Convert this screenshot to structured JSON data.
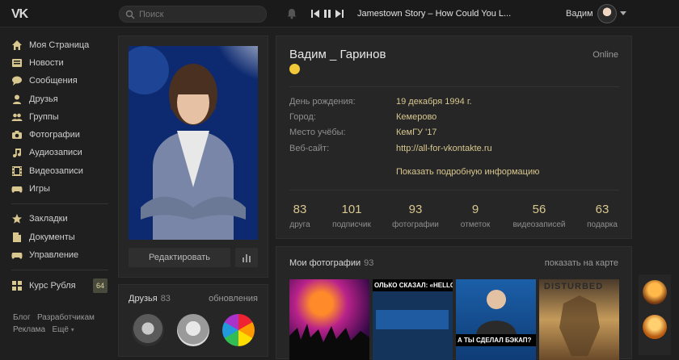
{
  "topbar": {
    "logo": "VK",
    "search_placeholder": "Поиск",
    "track": "Jamestown Story – How Could You L...",
    "user_name": "Вадим"
  },
  "sidebar": {
    "items": [
      {
        "label": "Моя Страница",
        "icon": "home-icon"
      },
      {
        "label": "Новости",
        "icon": "news-icon"
      },
      {
        "label": "Сообщения",
        "icon": "messages-icon"
      },
      {
        "label": "Друзья",
        "icon": "friend-icon"
      },
      {
        "label": "Группы",
        "icon": "groups-icon"
      },
      {
        "label": "Фотографии",
        "icon": "camera-icon"
      },
      {
        "label": "Аудиозаписи",
        "icon": "music-icon"
      },
      {
        "label": "Видеозаписи",
        "icon": "video-icon"
      },
      {
        "label": "Игры",
        "icon": "gamepad-icon"
      },
      {
        "label": "Закладки",
        "icon": "star-icon"
      },
      {
        "label": "Документы",
        "icon": "document-icon"
      },
      {
        "label": "Управление",
        "icon": "gamepad-icon"
      },
      {
        "label": "Курс Рубля",
        "icon": "apps-icon"
      }
    ],
    "badge": "64",
    "footer": {
      "blog": "Блог",
      "dev": "Разработчикам",
      "ads": "Реклама",
      "more": "Ещё"
    }
  },
  "photo_card": {
    "edit_label": "Редактировать"
  },
  "friends": {
    "title": "Друзья",
    "count": "83",
    "updates": "обновления"
  },
  "profile": {
    "name": "Вадим _ Гаринов",
    "status": "Online",
    "fields": [
      {
        "label": "День рождения:",
        "value": "19 декабря 1994 г."
      },
      {
        "label": "Город:",
        "value": "Кемерово"
      },
      {
        "label": "Место учёбы:",
        "value": "КемГУ '17"
      },
      {
        "label": "Веб-сайт:",
        "value": "http://all-for-vkontakte.ru"
      }
    ],
    "more_info": "Показать подробную информацию",
    "counters": [
      {
        "num": "83",
        "label": "друга"
      },
      {
        "num": "101",
        "label": "подписчик"
      },
      {
        "num": "93",
        "label": "фотографии"
      },
      {
        "num": "9",
        "label": "отметок"
      },
      {
        "num": "56",
        "label": "видеозаписей"
      },
      {
        "num": "63",
        "label": "подарка"
      }
    ]
  },
  "photos": {
    "title": "Мои фотографии",
    "count": "93",
    "map_link": "показать на карте",
    "thumbs": [
      {
        "caption": ""
      },
      {
        "caption": "ОЛЬКО СКАЗАЛ: «HELLO, GU"
      },
      {
        "caption": "А ТЫ СДЕЛАЛ БЭКАП?"
      },
      {
        "caption": "DISTURBED"
      }
    ]
  }
}
